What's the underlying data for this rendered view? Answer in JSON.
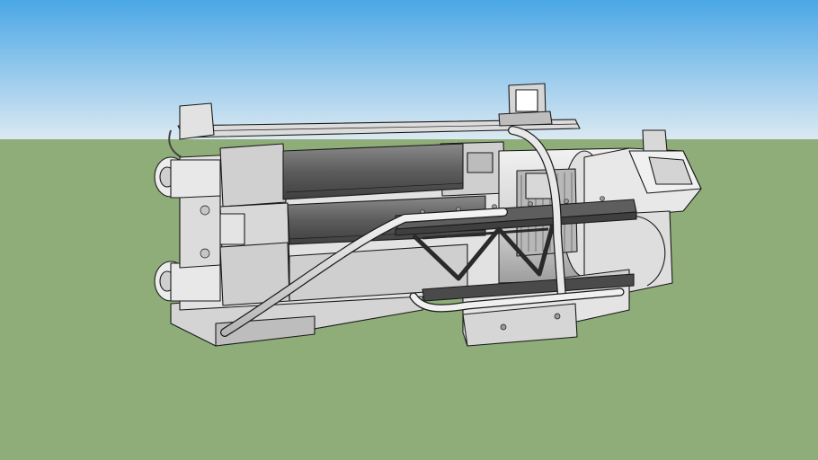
{
  "scene": {
    "model_subject": "sci-fi-gatling-gun-model",
    "colors": {
      "sky_top": "#4aa7e6",
      "sky_bottom": "#dbe9f2",
      "ground": "#8fad78",
      "body_light": "#e6e6e6",
      "body_mid": "#c8c8c8",
      "body_shadow": "#a9a9a9",
      "barrel_dark": "#5a5a5a",
      "barrel_mid": "#7a7a7a",
      "outline": "#1a1a1a"
    }
  }
}
